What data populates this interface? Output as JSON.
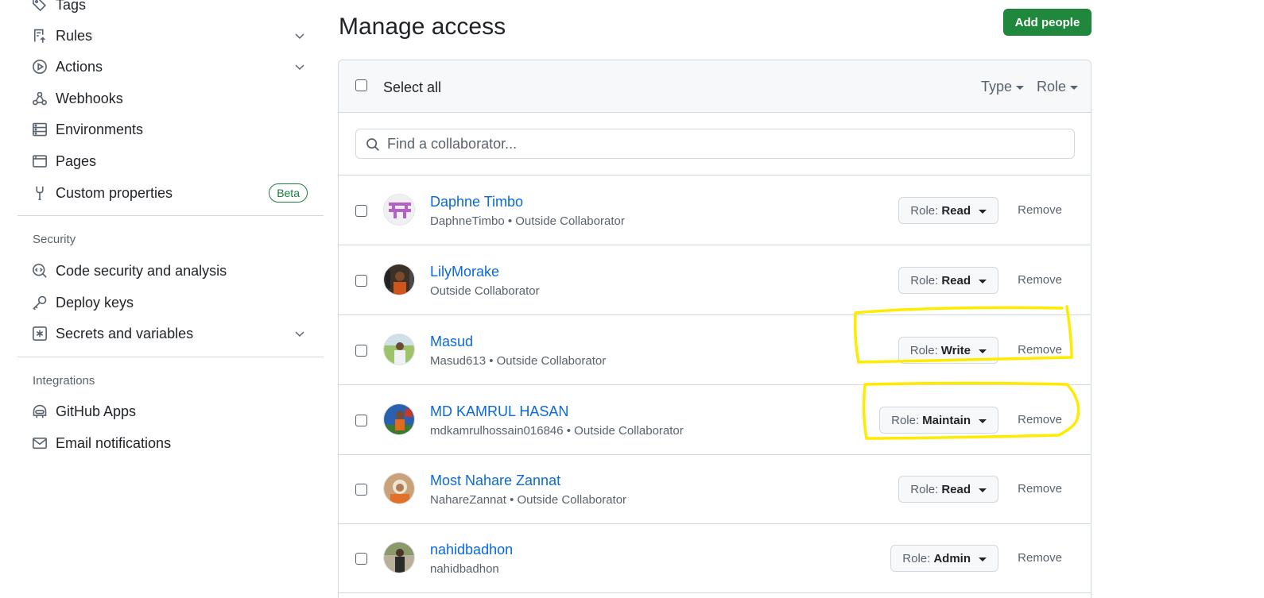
{
  "sidebar": {
    "items": [
      {
        "label": "Tags",
        "icon": "tag-icon"
      },
      {
        "label": "Rules",
        "icon": "rules-icon"
      },
      {
        "label": "Actions",
        "icon": "play-icon"
      },
      {
        "label": "Webhooks",
        "icon": "webhook-icon"
      },
      {
        "label": "Environments",
        "icon": "server-icon"
      },
      {
        "label": "Pages",
        "icon": "browser-icon"
      },
      {
        "label": "Custom properties",
        "icon": "tools-icon",
        "badge": "Beta"
      },
      {
        "label": "Code security and analysis",
        "icon": "codescan-icon"
      },
      {
        "label": "Deploy keys",
        "icon": "key-icon"
      },
      {
        "label": "Secrets and variables",
        "icon": "asterisk-icon"
      },
      {
        "label": "GitHub Apps",
        "icon": "hubot-icon"
      },
      {
        "label": "Email notifications",
        "icon": "mail-icon"
      }
    ],
    "sections": {
      "security": "Security",
      "integrations": "Integrations"
    }
  },
  "main": {
    "title": "Manage access",
    "add_button": "Add people",
    "select_all": "Select all",
    "filters": {
      "type": "Type",
      "role": "Role"
    },
    "search": {
      "placeholder": "Find a collaborator...",
      "value": ""
    },
    "role_prefix": "Role:",
    "remove_label": "Remove",
    "members": [
      {
        "name": "Daphne Timbo",
        "meta": "DaphneTimbo • Outside Collaborator",
        "role": "Read"
      },
      {
        "name": "LilyMorake",
        "meta": "Outside Collaborator",
        "role": "Read"
      },
      {
        "name": "Masud",
        "meta": "Masud613 • Outside Collaborator",
        "role": "Write"
      },
      {
        "name": "MD KAMRUL HASAN",
        "meta": "mdkamrulhossain016846 • Outside Collaborator",
        "role": "Maintain"
      },
      {
        "name": "Most Nahare Zannat",
        "meta": "NahareZannat • Outside Collaborator",
        "role": "Read"
      },
      {
        "name": "nahidbadhon",
        "meta": "nahidbadhon",
        "role": "Admin"
      }
    ]
  },
  "colors": {
    "accent_link": "#0969da",
    "primary_button": "#1f883d",
    "highlight": "#ffeb00"
  }
}
